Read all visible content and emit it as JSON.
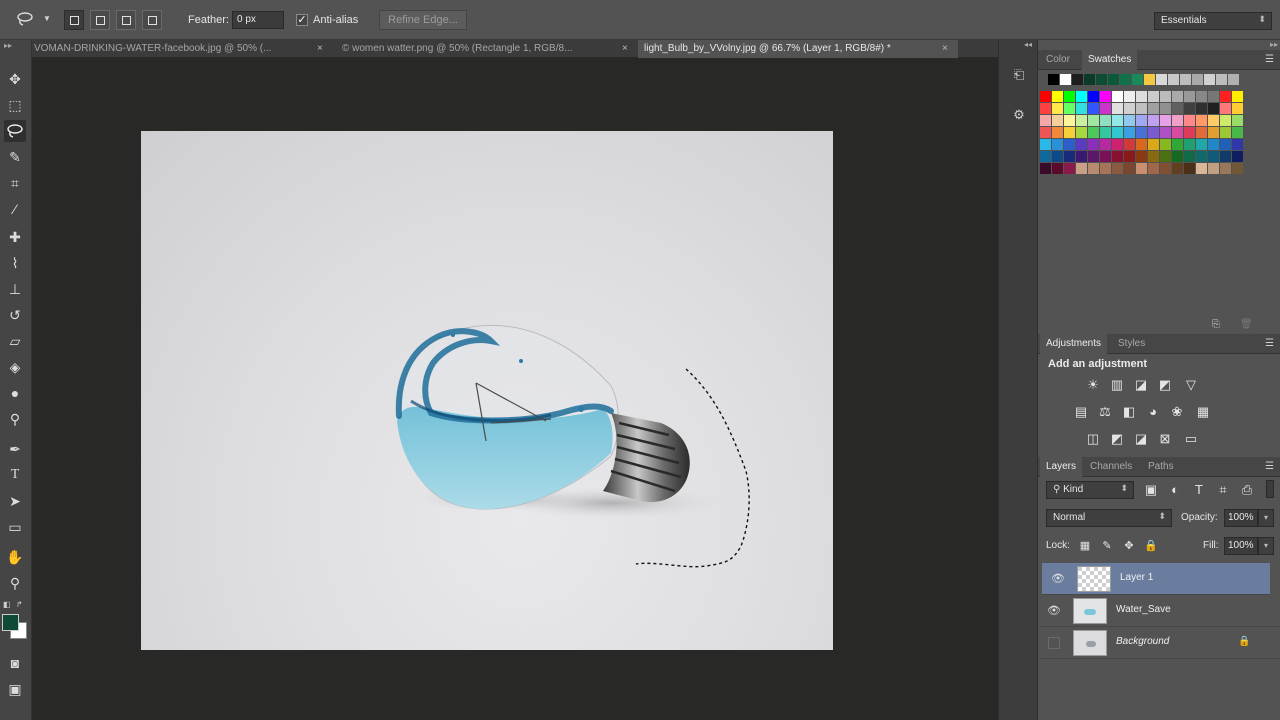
{
  "options_bar": {
    "feather_label": "Feather:",
    "feather_value": "0 px",
    "antialias_label": "Anti-alias",
    "antialias_check": "✓",
    "refine_edge_label": "Refine Edge...",
    "workspace_value": "Essentials"
  },
  "doc_tabs": [
    {
      "label": "VOMAN-DRINKING-WATER-facebook.jpg @ 50% (...",
      "close": "×"
    },
    {
      "label": "© women watter.png @ 50% (Rectangle 1, RGB/8...",
      "close": "×"
    },
    {
      "label": "light_Bulb_by_VVolny.jpg @ 66.7% (Layer 1, RGB/8#) *",
      "close": "×"
    }
  ],
  "color_panel": {
    "tabs": [
      "Color",
      "Swatches"
    ]
  },
  "adjustments_panel": {
    "tabs": [
      "Adjustments",
      "Styles"
    ],
    "heading": "Add an adjustment"
  },
  "layers_panel": {
    "tabs": [
      "Layers",
      "Channels",
      "Paths"
    ],
    "kind_filter": "Kind",
    "blend_mode": "Normal",
    "opacity_label": "Opacity:",
    "opacity_value": "100%",
    "lock_label": "Lock:",
    "fill_label": "Fill:",
    "fill_value": "100%",
    "layers": [
      {
        "name": "Layer 1",
        "visible": true,
        "selected": true
      },
      {
        "name": "Water_Save",
        "visible": true,
        "selected": false
      },
      {
        "name": "Background",
        "visible": false,
        "selected": false,
        "locked": true
      }
    ]
  },
  "colors": {
    "foreground": "#0f4a37",
    "background": "#ffffff",
    "selected_layer": "#6a7d9e",
    "water": "#7cc6dc"
  },
  "swatches": {
    "row0": [
      "#000000",
      "#ffffff",
      "#1e1e1e",
      "#0d3b2a",
      "#0d4d33",
      "#0a5a3a",
      "#12704a",
      "#1b8a5a",
      "#f5c842",
      "#d8d8d8",
      "#c8c8c8",
      "#bdbdbd",
      "#a8a8a8",
      "#d0d0d0",
      "#bcbcbc",
      "#b0b0b0"
    ],
    "grid": [
      [
        "#ff0000",
        "#ffff00",
        "#00ff00",
        "#00ffff",
        "#0000ff",
        "#ff00ff",
        "#ffffff",
        "#eeeeee",
        "#dddddd",
        "#cccccc",
        "#bbbbbb",
        "#aaaaaa",
        "#999999",
        "#888888",
        "#777777",
        "#ff2020",
        "#ffee00"
      ],
      [
        "#ff4040",
        "#ffe94a",
        "#66ff66",
        "#33e0e0",
        "#3355ff",
        "#cc33cc",
        "#e0e0e0",
        "#d0d0d0",
        "#c0c0c0",
        "#a0a0a0",
        "#909090",
        "#606060",
        "#404040",
        "#303030",
        "#202020",
        "#ff7777",
        "#ffcc33"
      ],
      [
        "#f6a6a6",
        "#f6d09a",
        "#fff59a",
        "#c8f0a0",
        "#a0e8a0",
        "#90e0c0",
        "#90e8e8",
        "#90c8f0",
        "#a0a8f0",
        "#c0a0f0",
        "#e8a0e8",
        "#f0a0c8",
        "#ff8888",
        "#ff9966",
        "#ffcc66",
        "#cceb66",
        "#99dd66"
      ],
      [
        "#ee5555",
        "#f08a3a",
        "#f5d03a",
        "#a8d840",
        "#4cc85a",
        "#35c7a0",
        "#30c8d0",
        "#3aa0e0",
        "#4a70d8",
        "#7a5ad0",
        "#b050c8",
        "#d84aa0",
        "#e03a5a",
        "#e06a3a",
        "#e0a030",
        "#9cc838",
        "#48b848"
      ],
      [
        "#2ab8e8",
        "#2a90d8",
        "#2a60c8",
        "#5a3ac0",
        "#8a30b8",
        "#b828a0",
        "#d02070",
        "#d03a3a",
        "#d86820",
        "#d8a818",
        "#88b820",
        "#30a838",
        "#20a070",
        "#20a8a8",
        "#2088c8",
        "#2060b8",
        "#3038a8"
      ],
      [
        "#0e6a9a",
        "#0e4a8a",
        "#1a2a7a",
        "#3a1a70",
        "#5a1868",
        "#7a1058",
        "#8a1030",
        "#8a1a1a",
        "#8a3a10",
        "#8a6a10",
        "#4a7010",
        "#166a20",
        "#106a4a",
        "#106a6a",
        "#105a7a",
        "#103a6a",
        "#0e1e5e"
      ],
      [
        "#3a0a2a",
        "#5a0a2a",
        "#8a1a4a",
        "#c8a088",
        "#b88a70",
        "#a87458",
        "#8a5a40",
        "#7a4830",
        "#c89070",
        "#a06848",
        "#805030",
        "#604020",
        "#4a3018",
        "#d8b898",
        "#c0a080",
        "#987858",
        "#705838"
      ]
    ]
  },
  "canvas": {
    "selection_note": "marching ants lasso selection"
  }
}
